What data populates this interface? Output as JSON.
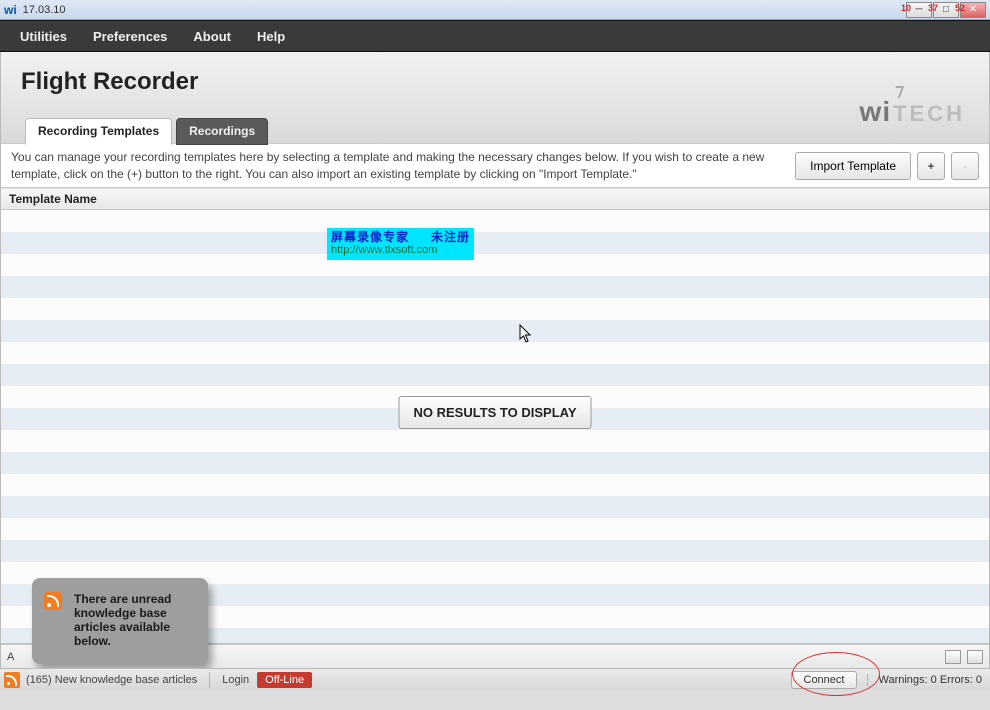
{
  "titlebar": {
    "app_icon_text": "wi",
    "version": "17.03.10"
  },
  "menubar": {
    "items": [
      "Utilities",
      "Preferences",
      "About",
      "Help"
    ]
  },
  "page": {
    "title": "Flight Recorder",
    "brand_wi": "wi",
    "brand_tech": "TECH"
  },
  "tabs": {
    "active": "Recording Templates",
    "items": [
      {
        "label": "Recording Templates",
        "active": true
      },
      {
        "label": "Recordings",
        "active": false
      }
    ]
  },
  "toolbar": {
    "description": "You can manage your recording templates here by selecting a template and making the necessary changes below.  If you wish to create a new template, click on the (+) button to the right.  You can also import an existing template by clicking on \"Import Template.\"",
    "import_label": "Import Template",
    "add_label": "+",
    "remove_label": "-"
  },
  "grid": {
    "column_header": "Template Name",
    "empty_message": "NO RESULTS TO DISPLAY"
  },
  "watermark": {
    "line1_left": "屏幕录像专家",
    "line1_right": "未注册",
    "line2": "http://www.tlxsoft.com"
  },
  "footer": {
    "left_marker": "A"
  },
  "popup": {
    "text": "There are unread knowledge base articles available below."
  },
  "statusbar": {
    "kb_count": "165",
    "kb_text": "New knowledge base articles",
    "login": "Login",
    "offline": "Off-Line",
    "connect": "Connect",
    "warnings_errors": "Warnings: 0 Errors: 0"
  },
  "window_controls": {
    "annot1": "10",
    "annot2": "37",
    "annot3": "52"
  }
}
